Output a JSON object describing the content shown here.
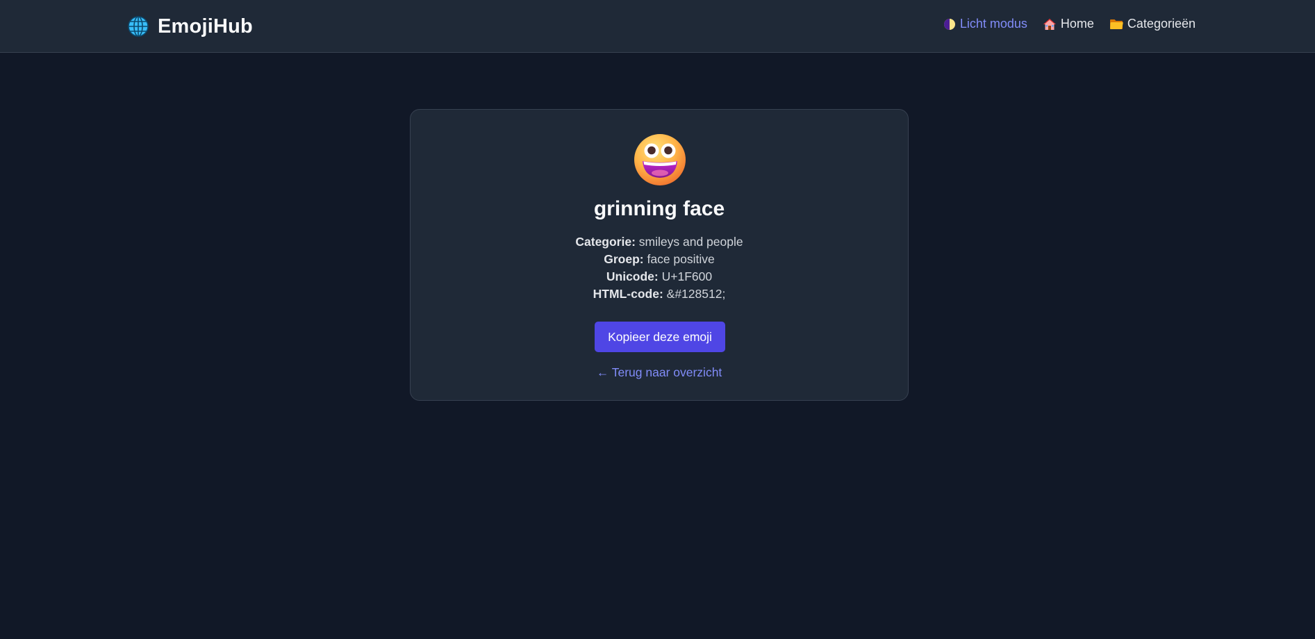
{
  "navbar": {
    "brand": {
      "icon": "globe-icon",
      "label": "EmojiHub"
    },
    "links": [
      {
        "icon": "half-moon-icon",
        "label": "Licht modus"
      },
      {
        "icon": "house-icon",
        "label": "Home"
      },
      {
        "icon": "folder-icon",
        "label": "Categorieën"
      }
    ]
  },
  "emoji": {
    "icon": "grinning-face-emoji",
    "name": "grinning face",
    "details": [
      {
        "label": "Categorie:",
        "value": "smileys and people"
      },
      {
        "label": "Groep:",
        "value": "face positive"
      },
      {
        "label": "Unicode:",
        "value": "U+1F600"
      },
      {
        "label": "HTML-code:",
        "value": "&#128512;"
      }
    ]
  },
  "actions": {
    "copy_label": "Kopieer deze emoji",
    "back_label": "← Terug naar overzicht"
  },
  "colors": {
    "background": "#111827",
    "surface": "#1f2937",
    "accent": "#4f46e5",
    "link": "#818cf8"
  }
}
